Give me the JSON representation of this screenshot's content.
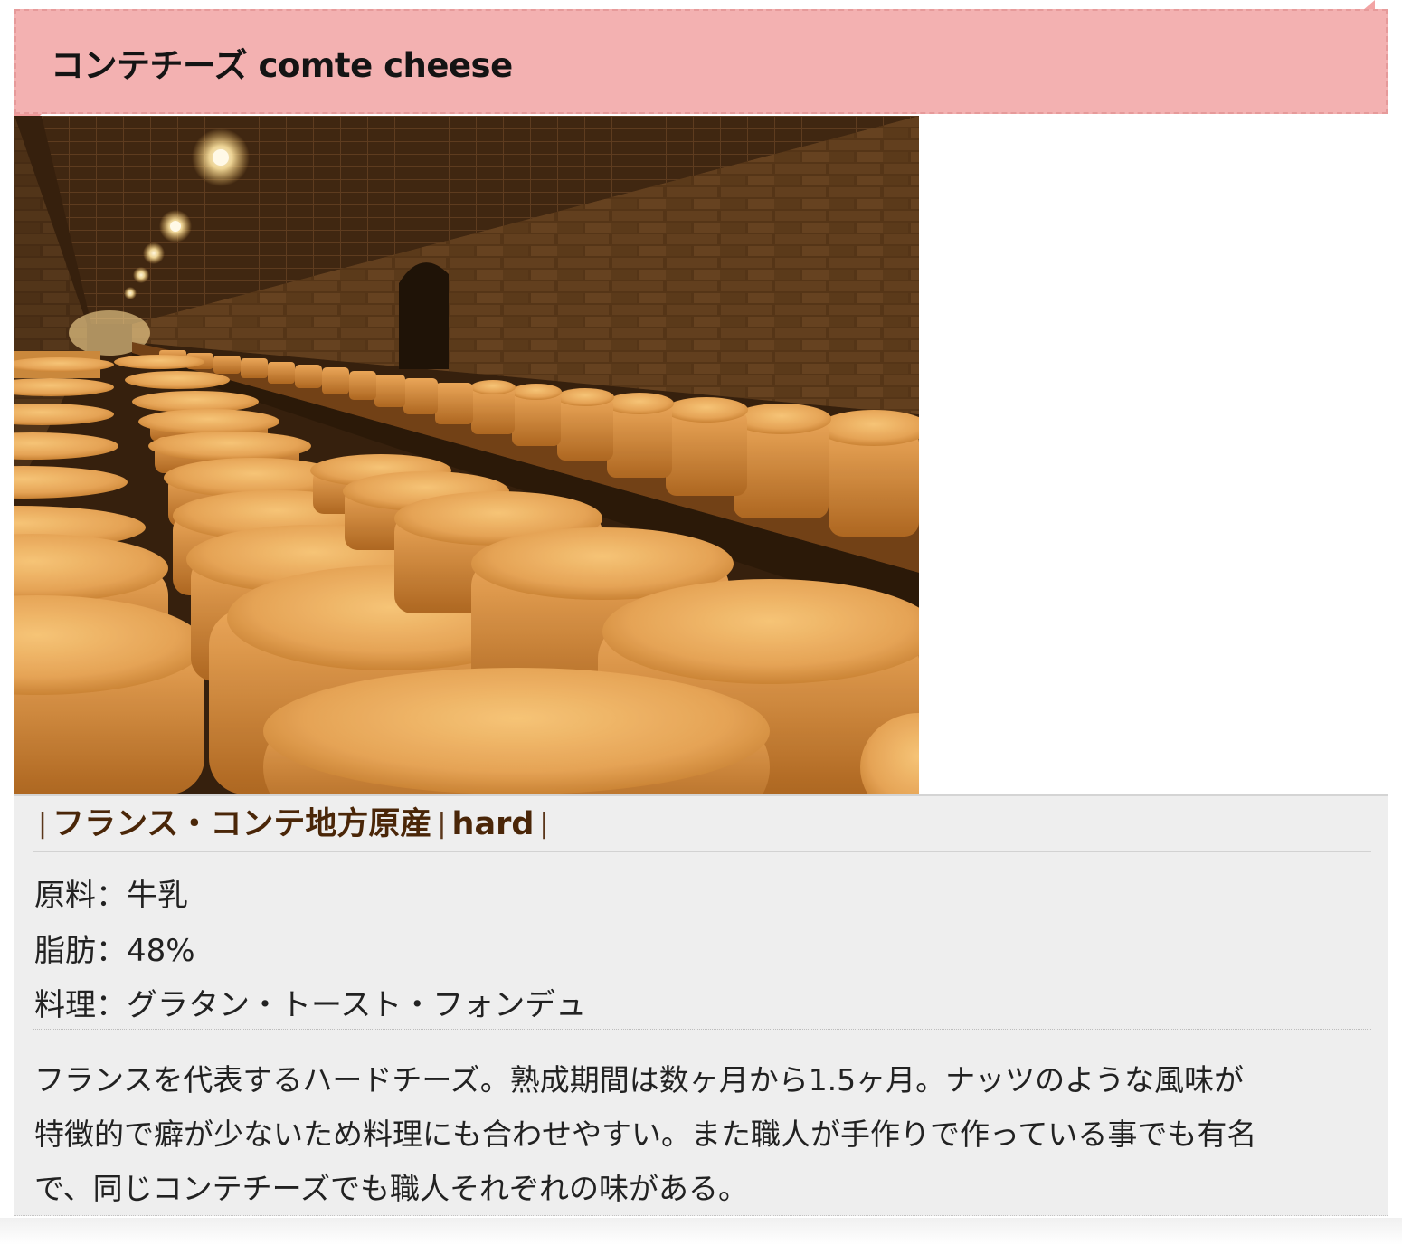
{
  "title": "コンテチーズ comte cheese",
  "photo": {
    "alt": "cheese-cellar-photo"
  },
  "origin": {
    "separator": "|",
    "region": "フランス・コンテ地方原産",
    "type": "hard"
  },
  "specs": [
    {
      "label": "原料",
      "value": "牛乳"
    },
    {
      "label": "脂肪",
      "value": "48%"
    },
    {
      "label": "料理",
      "value": "グラタン・トースト・フォンデュ"
    }
  ],
  "spec_separator": "：",
  "description": {
    "lines": [
      "フランスを代表するハードチーズ。熟成期間は数ヶ月から1.5ヶ月。ナッツのような風味が",
      "特徴的で癖が少ないため料理にも合わせやすい。また職人が手作りで作っている事でも有名",
      "で、同じコンテチーズでも職人それぞれの味がある。"
    ]
  },
  "colors": {
    "banner": "#f3b1b1",
    "origin_text": "#4a2608",
    "panel": "#eeeeee"
  }
}
